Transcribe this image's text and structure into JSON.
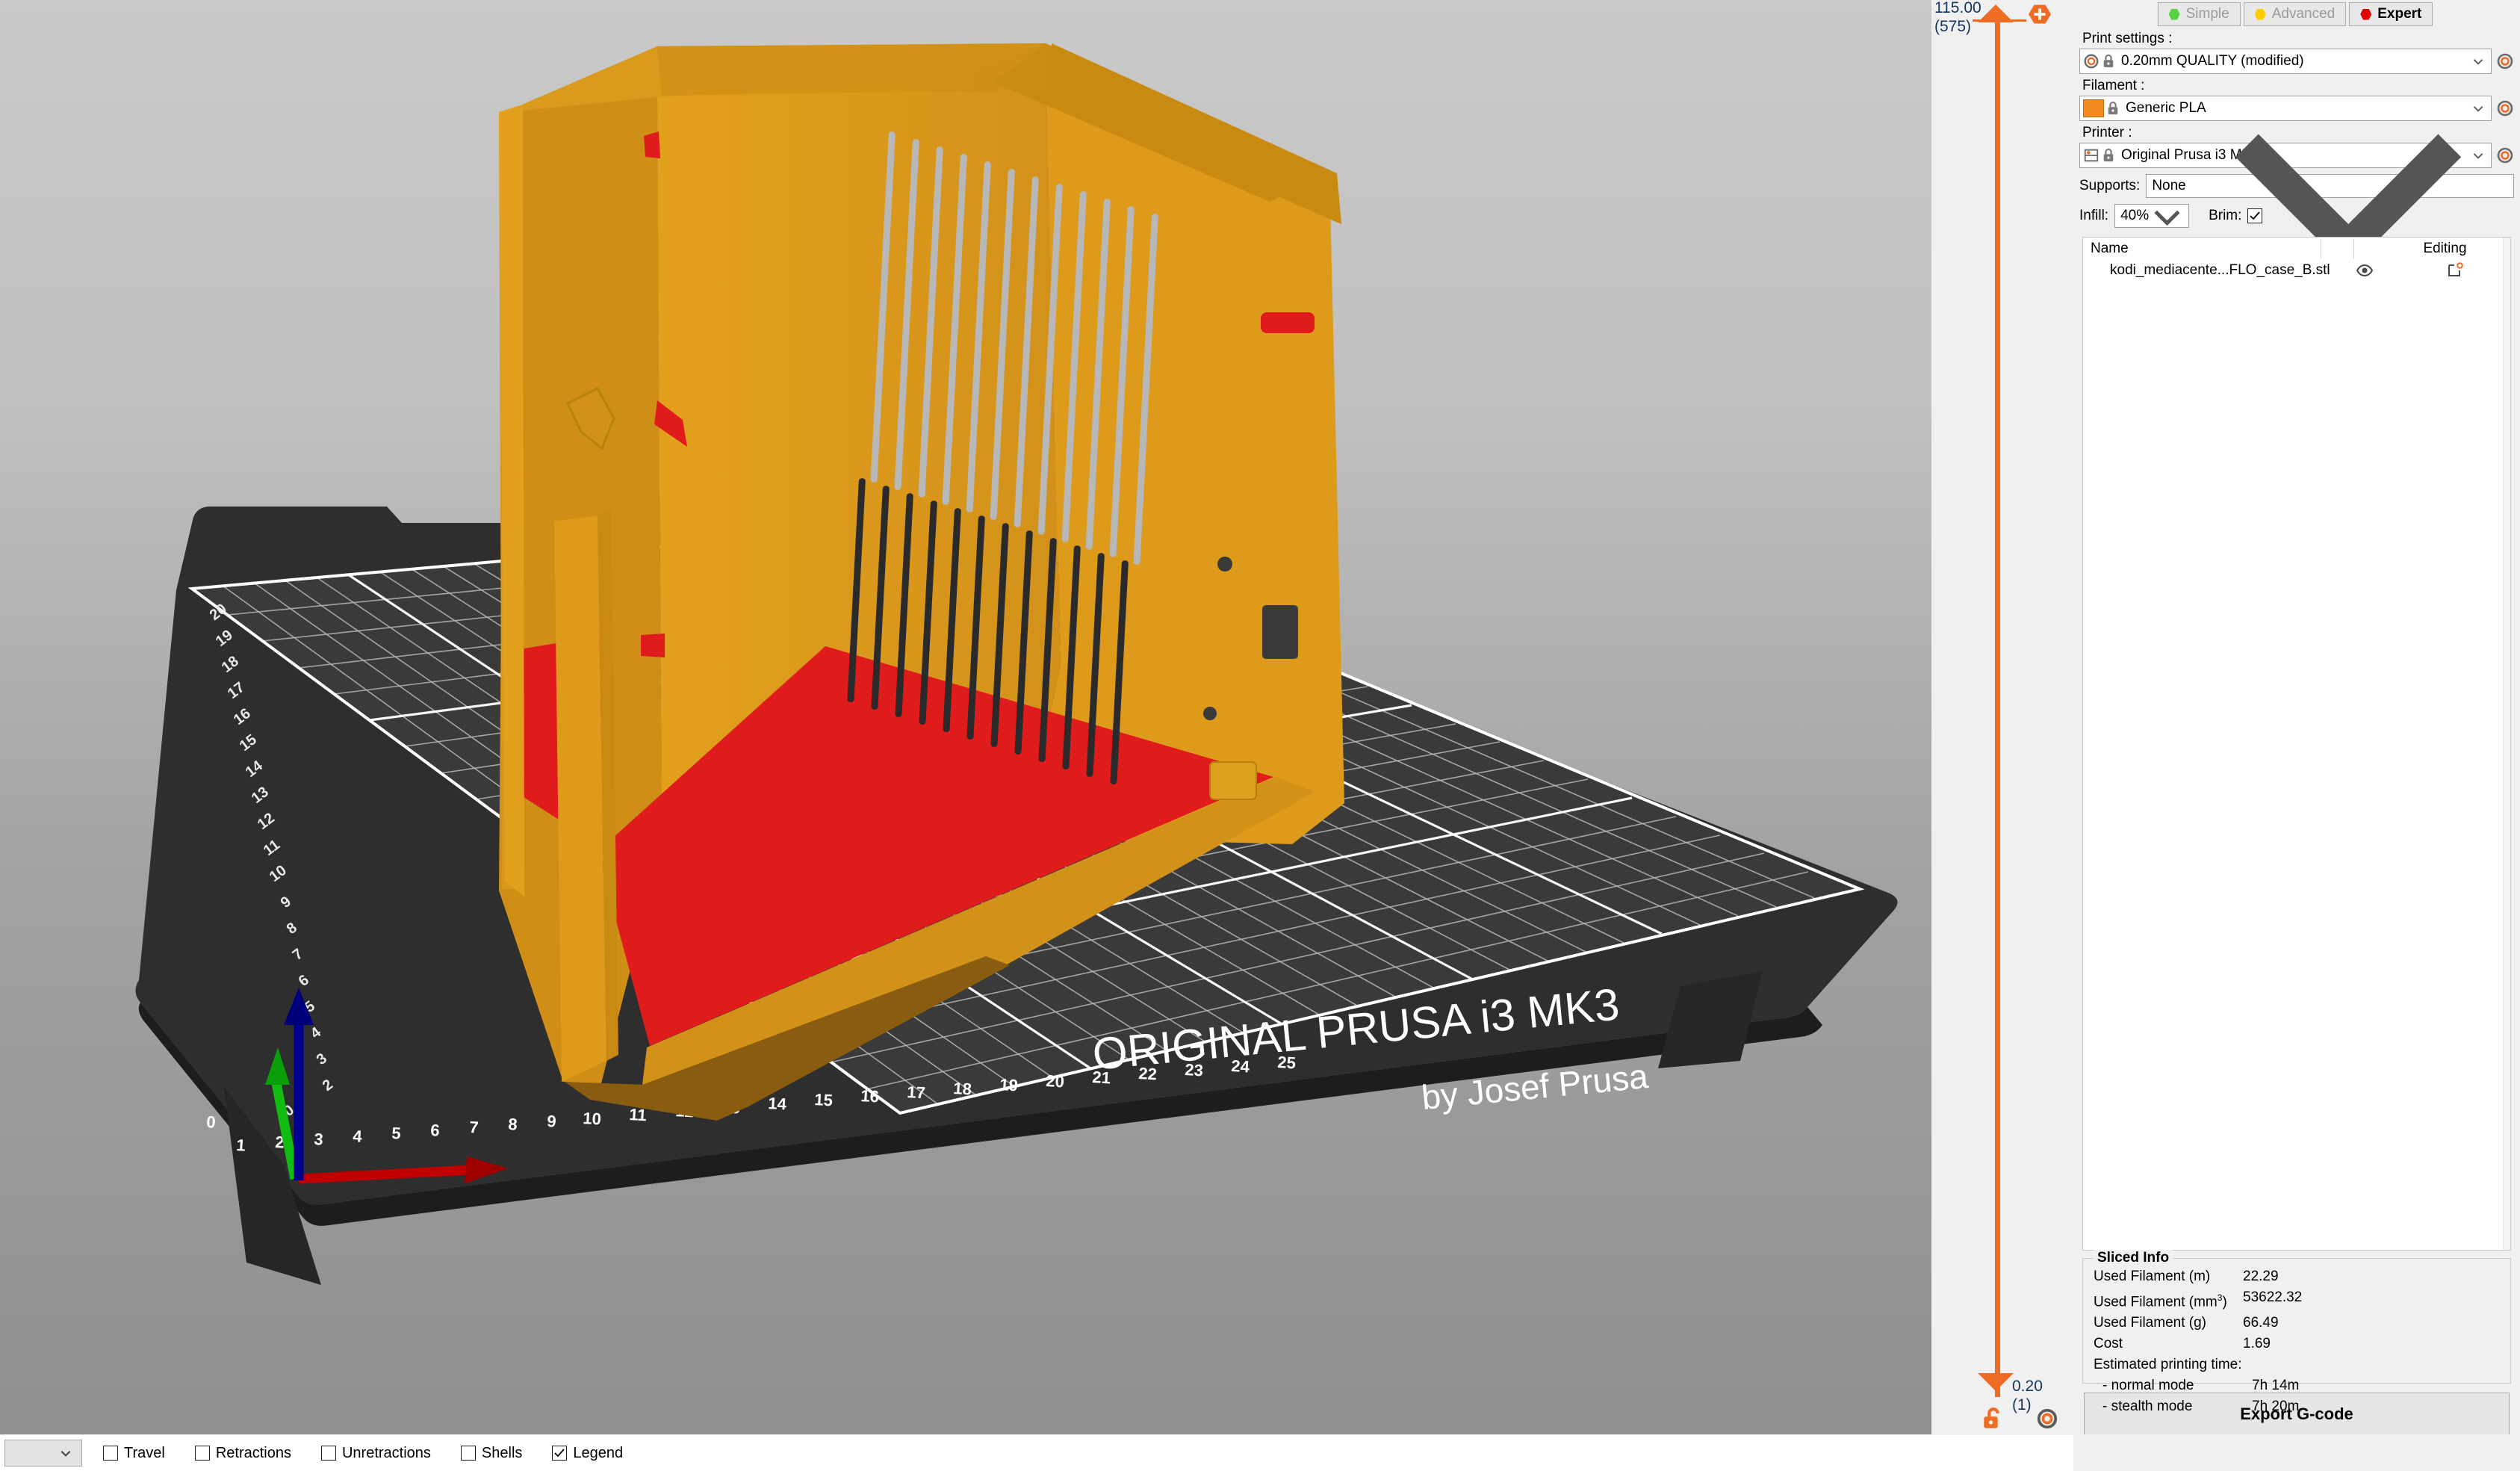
{
  "viewport": {
    "bed_brand_line1": "ORIGINAL PRUSA i3 MK3",
    "bed_brand_line2": "by Josef Prusa",
    "x_ticks": [
      "0",
      "1",
      "2",
      "3",
      "4",
      "5",
      "6",
      "7",
      "8",
      "9",
      "10",
      "11",
      "12",
      "13",
      "14",
      "15",
      "16",
      "17",
      "18",
      "19",
      "20",
      "21",
      "22",
      "23",
      "24",
      "25"
    ],
    "y_ticks": [
      "0",
      "1",
      "2",
      "3",
      "4",
      "5",
      "6",
      "7",
      "8",
      "9",
      "10",
      "11",
      "12",
      "13",
      "14",
      "15",
      "16",
      "17",
      "18",
      "19",
      "20"
    ],
    "axis_x_color": "#c00000",
    "axis_y_color": "#00a000",
    "axis_z_color": "#00008f",
    "model_color": "#e0971a",
    "model_solid_infill_color": "#e01b1b",
    "bed_color": "#3b3b3b",
    "background_top": "#c9c9c9",
    "background_bottom": "#8f8f8f"
  },
  "layer_slider": {
    "high_value": "115.00",
    "high_layer": "(575)",
    "low_value": "0.20",
    "low_layer": "(1)",
    "accent_color": "#ef6c25",
    "label_color": "#13355e",
    "plus_icon": "plus-hex-icon",
    "lock_icon": "unlocked-padlock-icon",
    "gear_icon": "gear-icon"
  },
  "sidebar": {
    "modes": [
      {
        "label": "Simple",
        "color": "#5ad142",
        "active": false
      },
      {
        "label": "Advanced",
        "color": "#ffcc00",
        "active": false
      },
      {
        "label": "Expert",
        "color": "#e00000",
        "active": true
      }
    ],
    "print_settings": {
      "label": "Print settings :",
      "value": "0.20mm QUALITY (modified)",
      "icon": "gear-icon",
      "lock_icon": "locked-padlock-icon"
    },
    "filament": {
      "label": "Filament :",
      "value": "Generic PLA",
      "swatch_color": "#f58a1f",
      "lock_icon": "locked-padlock-icon"
    },
    "printer": {
      "label": "Printer :",
      "value": "Original Prusa i3 MK3",
      "icon": "printer-icon",
      "lock_icon": "locked-padlock-icon"
    },
    "supports": {
      "label": "Supports:",
      "value": "None"
    },
    "infill": {
      "label": "Infill:",
      "value": "40%"
    },
    "brim": {
      "label": "Brim:",
      "checked": true
    },
    "object_list": {
      "columns": [
        "Name",
        "",
        "Editing"
      ],
      "rows": [
        {
          "name": "kodi_mediacente...FLO_case_B.stl",
          "eye_icon": "eye-icon",
          "editing_icon": "edit-object-icon"
        }
      ]
    },
    "sliced_info": {
      "title": "Sliced Info",
      "rows": [
        {
          "key": "Used Filament (m)",
          "value": "22.29"
        },
        {
          "key": "Used Filament (mm³)",
          "value": "53622.32",
          "sup": "3",
          "key_base": "Used Filament (mm"
        },
        {
          "key": "Used Filament (g)",
          "value": "66.49"
        },
        {
          "key": "Cost",
          "value": "1.69"
        }
      ],
      "time_label": "Estimated printing time:",
      "times": [
        {
          "key": "- normal mode",
          "value": "7h 14m"
        },
        {
          "key": "- stealth mode",
          "value": "7h 20m"
        }
      ]
    },
    "export_button": "Export G-code"
  },
  "bottom_bar": {
    "view_select_value": "",
    "legend_toggles": [
      {
        "label": "Travel",
        "checked": false
      },
      {
        "label": "Retractions",
        "checked": false
      },
      {
        "label": "Unretractions",
        "checked": false
      },
      {
        "label": "Shells",
        "checked": false
      },
      {
        "label": "Legend",
        "checked": true
      }
    ]
  }
}
